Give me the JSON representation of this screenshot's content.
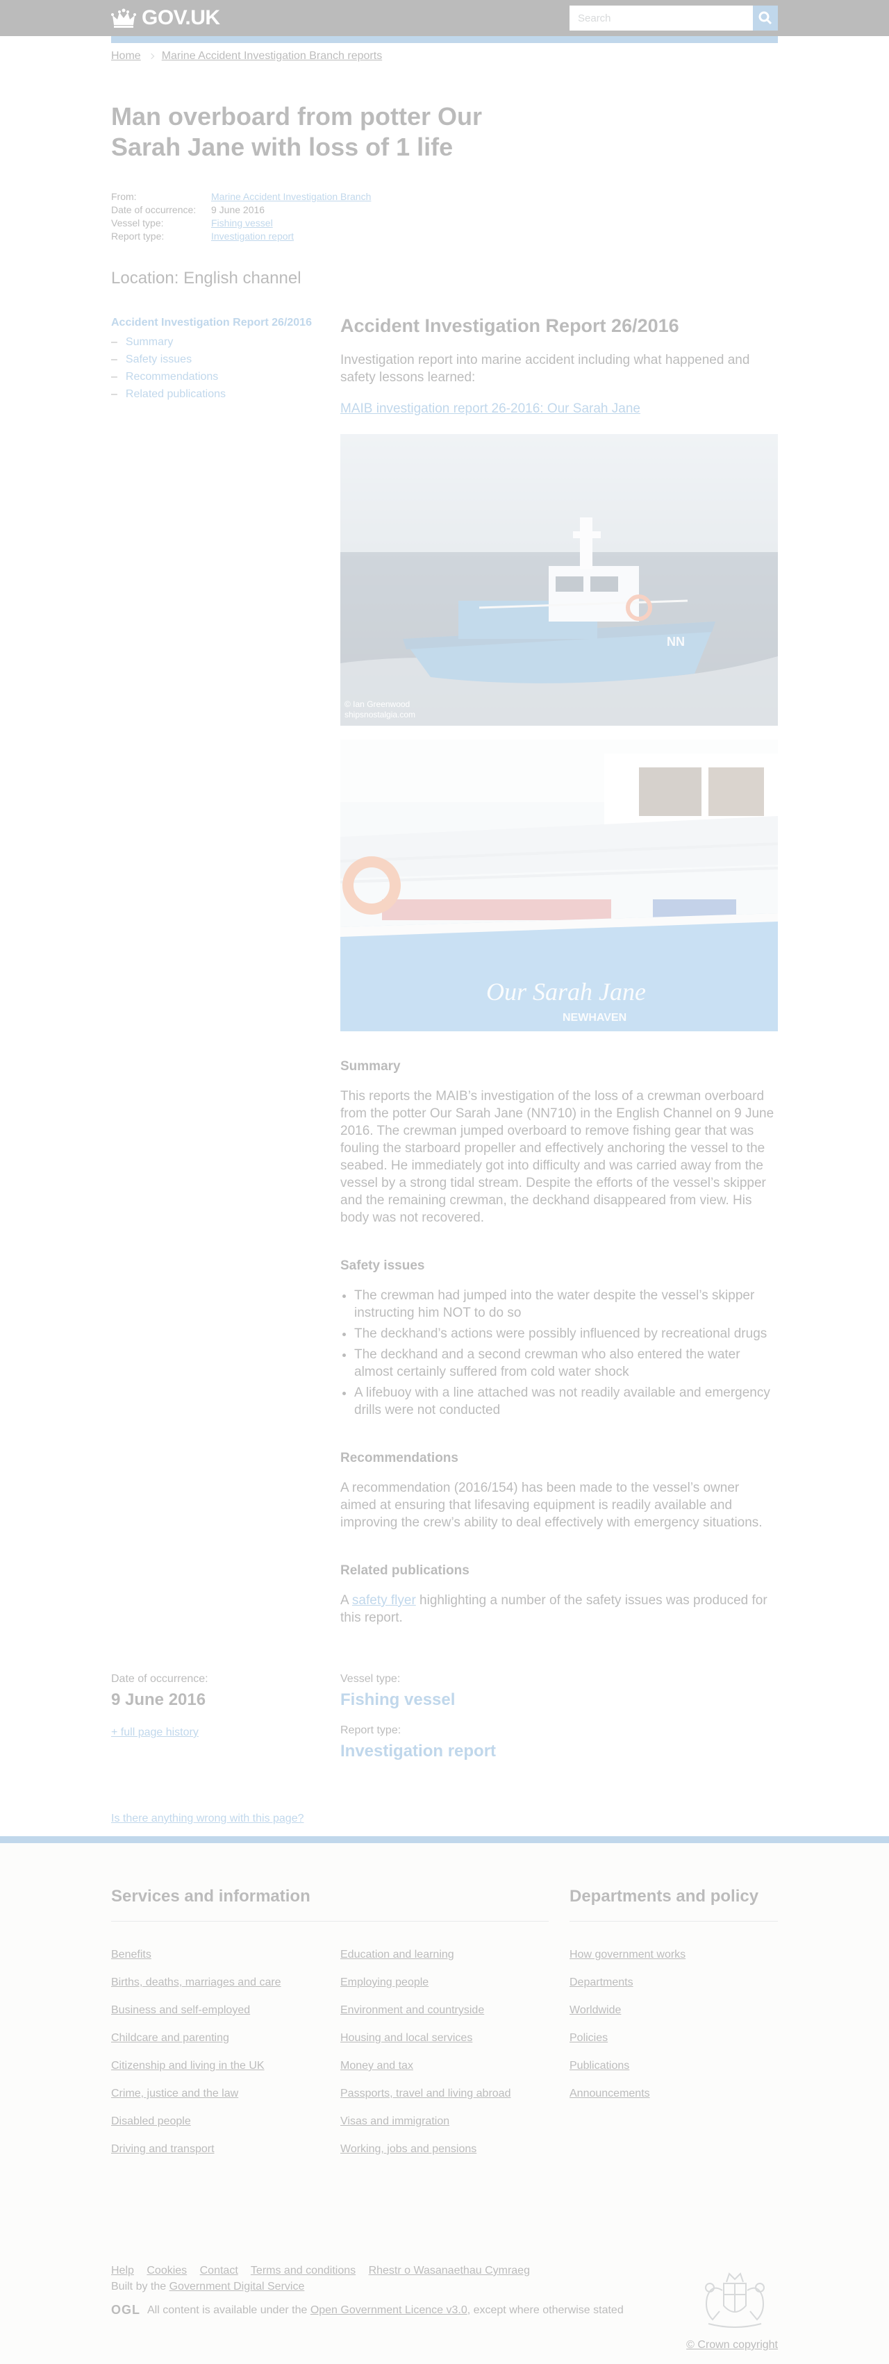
{
  "header": {
    "logo_text": "GOV.UK",
    "search_placeholder": "Search"
  },
  "breadcrumbs": [
    {
      "label": "Home"
    },
    {
      "label": "Marine Accident Investigation Branch reports"
    }
  ],
  "page": {
    "title": "Man overboard from potter Our Sarah Jane with loss of 1 life",
    "metadata": {
      "from_label": "From:",
      "from_value": "Marine Accident Investigation Branch",
      "date_label": "Date of occurrence:",
      "date_value": "9 June 2016",
      "vessel_label": "Vessel type:",
      "vessel_value": "Fishing vessel",
      "report_label": "Report type:",
      "report_value": "Investigation report"
    },
    "location": "Location: English channel"
  },
  "sidebar": {
    "title": "Accident Investigation Report 26/2016",
    "items": [
      {
        "label": "Summary"
      },
      {
        "label": "Safety issues"
      },
      {
        "label": "Recommendations"
      },
      {
        "label": "Related publications"
      }
    ]
  },
  "content": {
    "report_title": "Accident Investigation Report 26/2016",
    "lead": "Investigation report into marine accident including what happened and safety lessons learned:",
    "doc_link": "MAIB investigation report 26-2016: Our Sarah Jane",
    "photo1_credit_line1": "© Ian Greenwood",
    "photo1_credit_line2": "shipsnostalgia.com",
    "boat_name": "Our Sarah Jane",
    "boat_port": "NEWHAVEN",
    "summary_heading": "Summary",
    "summary_text": "This reports the MAIB’s investigation of the loss of a crewman overboard from the potter Our Sarah Jane (NN710) in the English Channel on 9 June 2016. The crewman jumped overboard to remove fishing gear that was fouling the starboard propeller and effectively anchoring the vessel to the seabed. He immediately got into difficulty and was carried away from the vessel by a strong tidal stream. Despite the efforts of the vessel’s skipper and the remaining crewman, the deckhand disappeared from view. His body was not recovered.",
    "safety_heading": "Safety issues",
    "safety_items": [
      "The crewman had jumped into the water despite the vessel’s skipper instructing him NOT to do so",
      "The deckhand’s actions were possibly influenced by recreational drugs",
      "The deckhand and a second crewman who also entered the water almost certainly suffered from cold water shock",
      "A lifebuoy with a line attached was not readily available and emergency drills were not conducted"
    ],
    "recommendations_heading": "Recommendations",
    "recommendations_text": "A recommendation (2016/154) has been made to the vessel’s owner aimed at ensuring that lifesaving equipment is readily available and improving the crew’s ability to deal effectively with emergency situations.",
    "related_heading": "Related publications",
    "related_prefix": "A ",
    "related_link": "safety flyer",
    "related_suffix": " highlighting a number of the safety issues was produced for this report."
  },
  "bottom_meta": {
    "date_label": "Date of occurrence:",
    "date_value": "9 June 2016",
    "history_link": "+ full page history",
    "vessel_label": "Vessel type:",
    "vessel_value": "Fishing vessel",
    "report_label": "Report type:",
    "report_value": "Investigation report",
    "report_problem": "Is there anything wrong with this page?"
  },
  "footer": {
    "services_heading": "Services and information",
    "services_col1": [
      "Benefits",
      "Births, deaths, marriages and care",
      "Business and self-employed",
      "Childcare and parenting",
      "Citizenship and living in the UK",
      "Crime, justice and the law",
      "Disabled people",
      "Driving and transport"
    ],
    "services_col2": [
      "Education and learning",
      "Employing people",
      "Environment and countryside",
      "Housing and local services",
      "Money and tax",
      "Passports, travel and living abroad",
      "Visas and immigration",
      "Working, jobs and pensions"
    ],
    "departments_heading": "Departments and policy",
    "departments_items": [
      "How government works",
      "Departments",
      "Worldwide",
      "Policies",
      "Publications",
      "Announcements"
    ],
    "links": [
      "Help",
      "Cookies",
      "Contact",
      "Terms and conditions",
      "Rhestr o Wasanaethau Cymraeg"
    ],
    "built_prefix": "Built by the ",
    "built_link": "Government Digital Service",
    "ogl": "OGL",
    "licence_prefix": "All content is available under the ",
    "licence_link": "Open Government Licence v3.0",
    "licence_suffix": ", except where otherwise stated",
    "crown_copyright": "© Crown copyright"
  },
  "colors": {
    "header_bg": "#0b0c0c",
    "link": "#1d70b8",
    "footer_bg": "#f3f2f1"
  }
}
